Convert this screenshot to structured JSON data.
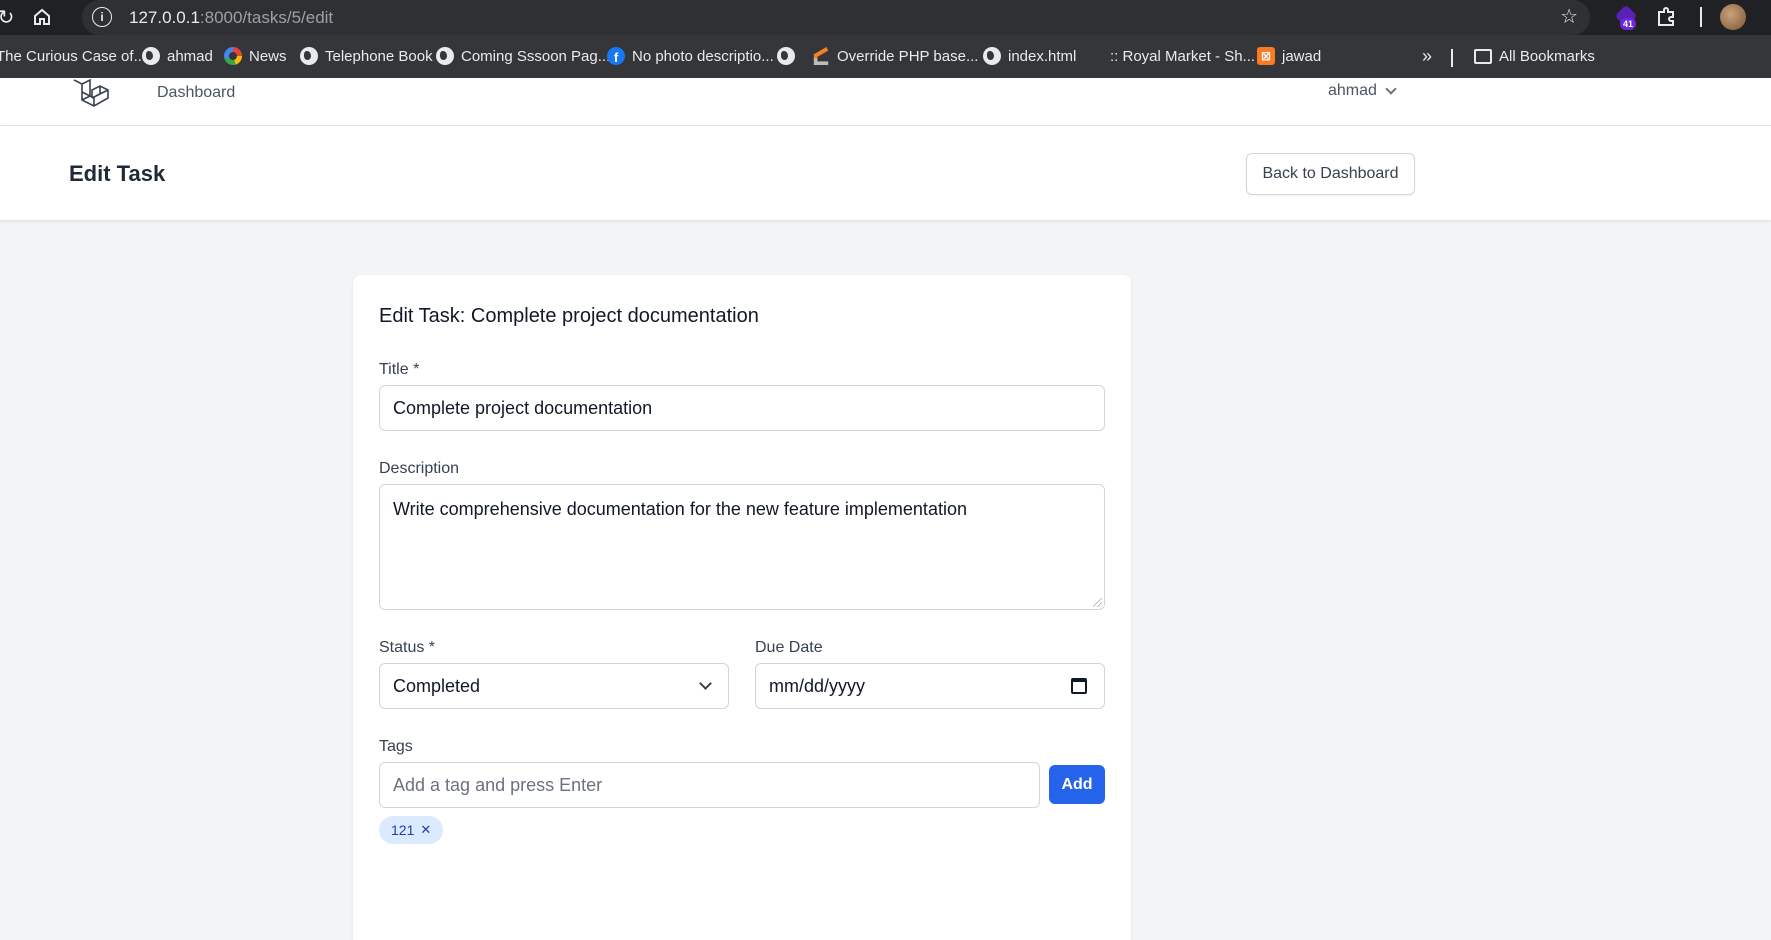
{
  "browser": {
    "url_host": "127.0.0.1",
    "url_path": ":8000/tasks/5/edit",
    "extension_badge": "41",
    "bookmarks": [
      {
        "label": "The Curious Case of...",
        "icon": "none"
      },
      {
        "label": "ahmad",
        "icon": "globe-icon"
      },
      {
        "label": "News",
        "icon": "google-icon"
      },
      {
        "label": "Telephone Book",
        "icon": "globe-icon"
      },
      {
        "label": "Coming Sssoon Pag...",
        "icon": "globe-icon"
      },
      {
        "label": "No photo descriptio...",
        "icon": "facebook-icon"
      },
      {
        "label": "",
        "icon": "globe-icon"
      },
      {
        "label": "Override PHP base...",
        "icon": "stackoverflow-icon"
      },
      {
        "label": "index.html",
        "icon": "globe-icon"
      },
      {
        "label": ":: Royal Market - Sh...",
        "icon": "none"
      },
      {
        "label": "jawad",
        "icon": "xampp-icon"
      }
    ],
    "overflow_label": "»",
    "all_bookmarks_label": "All Bookmarks"
  },
  "nav": {
    "dashboard_link": "Dashboard",
    "user_name": "ahmad"
  },
  "header": {
    "title": "Edit Task",
    "back_button": "Back to Dashboard"
  },
  "form": {
    "heading": "Edit Task: Complete project documentation",
    "title_label": "Title *",
    "title_value": "Complete project documentation",
    "description_label": "Description",
    "description_value": "Write comprehensive documentation for the new feature implementation",
    "status_label": "Status *",
    "status_value": "Completed",
    "due_date_label": "Due Date",
    "due_date_placeholder": "mm/dd/yyyy",
    "tags_label": "Tags",
    "tags_placeholder": "Add a tag and press Enter",
    "add_button": "Add",
    "tags": [
      "121"
    ]
  },
  "colors": {
    "accent": "#2563eb",
    "chip_bg": "#dbeafe"
  }
}
